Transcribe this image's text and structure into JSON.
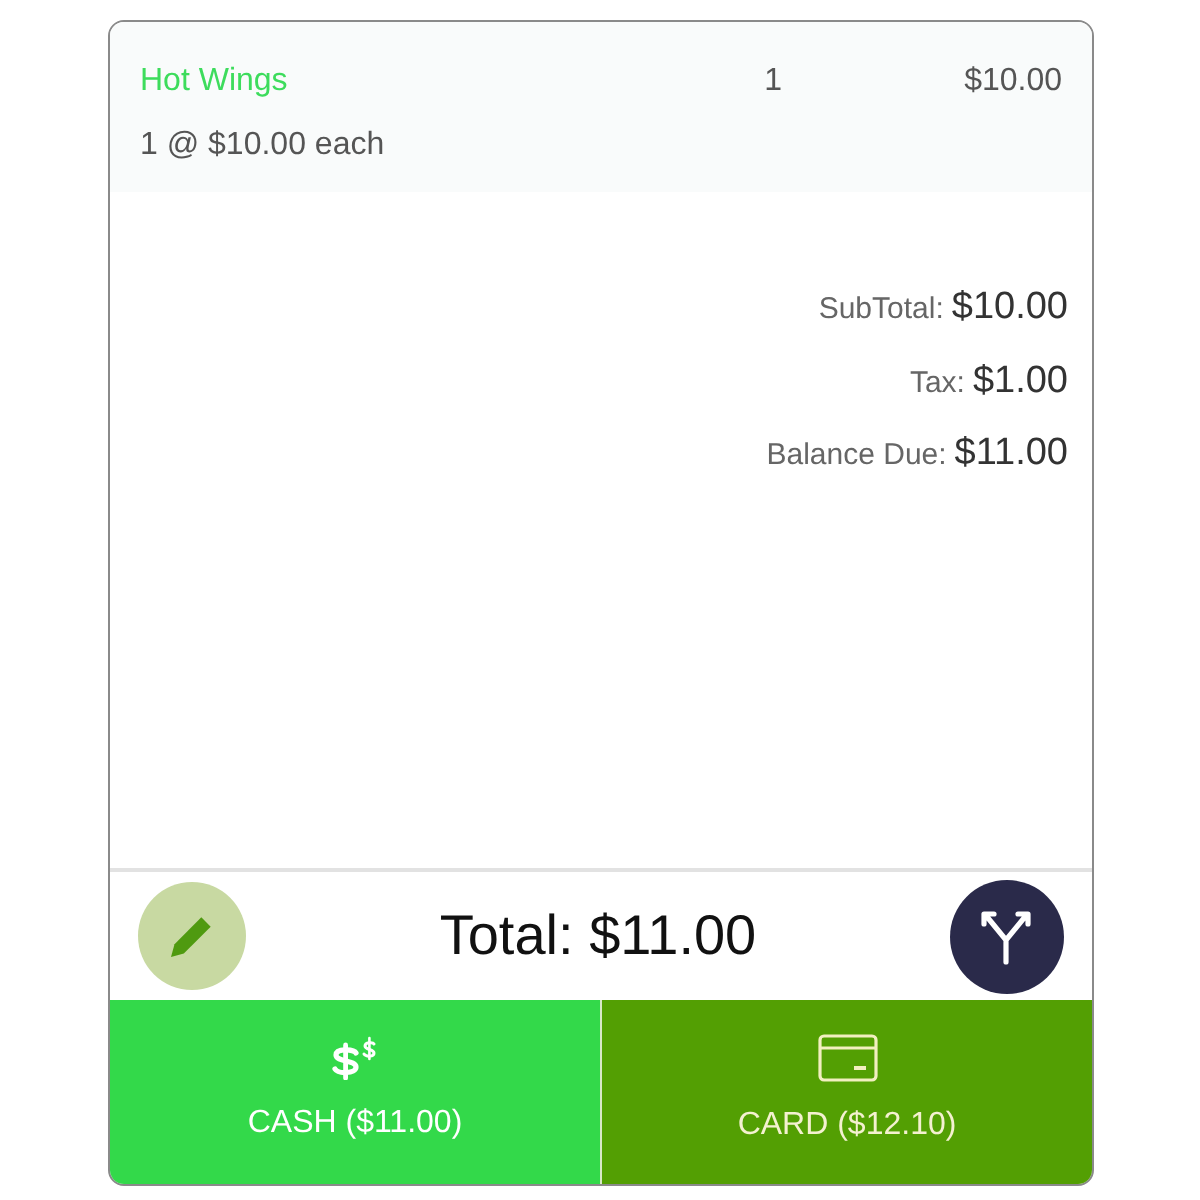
{
  "order_items": [
    {
      "name": "Hot Wings",
      "quantity": "1",
      "price": "$10.00",
      "detail": "1 @ $10.00 each"
    }
  ],
  "summary": [
    {
      "label": "SubTotal:",
      "value": "$10.00"
    },
    {
      "label": "Tax:",
      "value": "$1.00"
    },
    {
      "label": "Balance Due:",
      "value": "$11.00"
    }
  ],
  "total": "Total: $11.00",
  "payment_buttons": [
    {
      "kind": "cash",
      "label": "CASH ($11.00)",
      "color": "#33d94a"
    },
    {
      "kind": "card",
      "label": "CARD ($12.10)",
      "color": "#539f03"
    }
  ]
}
